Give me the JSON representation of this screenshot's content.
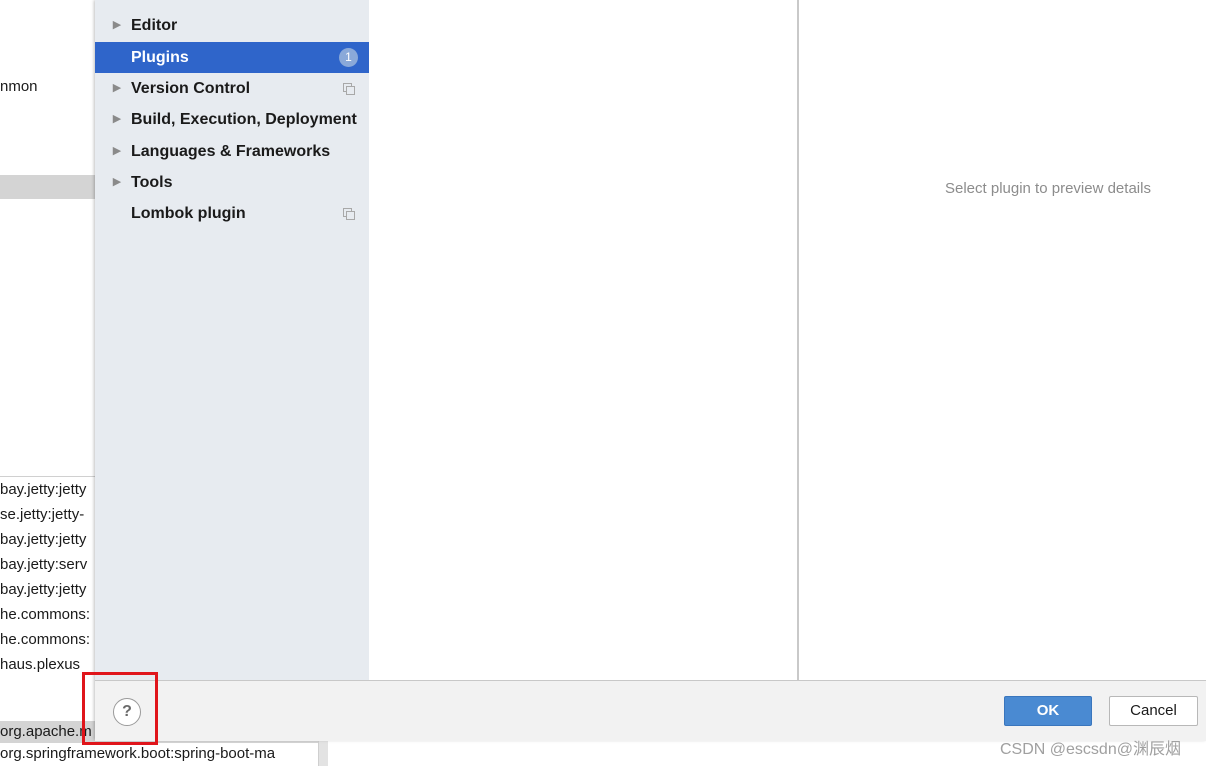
{
  "background": {
    "top_text": "nmon",
    "list_rows": [
      "bay.jetty:jetty",
      "se.jetty:jetty-",
      "bay.jetty:jetty",
      "bay.jetty:serv",
      "bay.jetty:jetty",
      "he.commons:",
      "he.commons:",
      "haus.plexus"
    ],
    "bottom_rows": [
      "org.apache.m",
      "org.springframework.boot:spring-boot-ma"
    ]
  },
  "nav": {
    "items": [
      {
        "label": "Editor",
        "expandable": true
      },
      {
        "label": "Plugins",
        "expandable": false,
        "badge": "1",
        "selected": true
      },
      {
        "label": "Version Control",
        "expandable": true,
        "copy_icon": "copy-icon"
      },
      {
        "label": "Build, Execution, Deployment",
        "expandable": true
      },
      {
        "label": "Languages & Frameworks",
        "expandable": true
      },
      {
        "label": "Tools",
        "expandable": true
      },
      {
        "label": "Lombok plugin",
        "expandable": false,
        "copy_icon": "copy-icon"
      }
    ]
  },
  "detail": {
    "hint": "Select plugin to preview details"
  },
  "footer": {
    "help_label": "?",
    "ok_label": "OK",
    "cancel_label": "Cancel"
  },
  "watermark": "CSDN @escsdn@渊辰烟",
  "colors": {
    "nav_bg": "#e7ebf0",
    "selected_bg": "#2f65ca",
    "ok_bg": "#4a8ad2",
    "highlight_border": "#e0151b"
  },
  "icons": [
    "expand-arrow-icon",
    "copy-icon",
    "loading-spinner-icon",
    "help-icon"
  ]
}
